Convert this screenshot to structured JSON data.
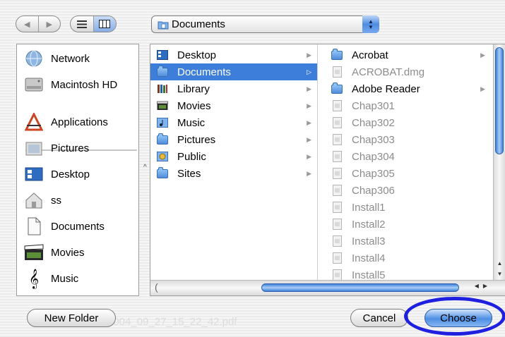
{
  "toolbar": {
    "back_icon": "back-arrow-icon",
    "forward_icon": "forward-arrow-icon",
    "list_view_icon": "list-view-icon",
    "column_view_icon": "column-view-icon"
  },
  "path_popup": {
    "label": "Documents",
    "icon": "documents-folder-icon"
  },
  "sidebar": {
    "items": [
      {
        "label": "Network",
        "icon": "network-globe-icon"
      },
      {
        "label": "Macintosh HD",
        "icon": "hard-drive-icon"
      },
      {
        "label": "Applications",
        "icon": "applications-icon"
      },
      {
        "label": "Pictures",
        "icon": "pictures-folder-icon"
      },
      {
        "label": "Desktop",
        "icon": "desktop-folder-icon"
      },
      {
        "label": "ss",
        "icon": "home-icon"
      },
      {
        "label": "Documents",
        "icon": "document-icon"
      },
      {
        "label": "Movies",
        "icon": "movies-clapper-icon"
      },
      {
        "label": "Music",
        "icon": "music-note-icon"
      }
    ]
  },
  "browser": {
    "column1": [
      {
        "label": "Desktop",
        "selected": false
      },
      {
        "label": "Documents",
        "selected": true
      },
      {
        "label": "Library",
        "selected": false
      },
      {
        "label": "Movies",
        "selected": false
      },
      {
        "label": "Music",
        "selected": false
      },
      {
        "label": "Pictures",
        "selected": false
      },
      {
        "label": "Public",
        "selected": false
      },
      {
        "label": "Sites",
        "selected": false
      }
    ],
    "column2": [
      {
        "label": "Acrobat",
        "type": "folder"
      },
      {
        "label": "ACROBAT.dmg",
        "type": "file"
      },
      {
        "label": "Adobe Reader",
        "type": "folder"
      },
      {
        "label": "Chap301",
        "type": "file"
      },
      {
        "label": "Chap302",
        "type": "file"
      },
      {
        "label": "Chap303",
        "type": "file"
      },
      {
        "label": "Chap304",
        "type": "file"
      },
      {
        "label": "Chap305",
        "type": "file"
      },
      {
        "label": "Chap306",
        "type": "file"
      },
      {
        "label": "Install1",
        "type": "file"
      },
      {
        "label": "Install2",
        "type": "file"
      },
      {
        "label": "Install3",
        "type": "file"
      },
      {
        "label": "Install4",
        "type": "file"
      },
      {
        "label": "Install5",
        "type": "file"
      }
    ]
  },
  "buttons": {
    "new_folder": "New Folder",
    "cancel": "Cancel",
    "choose": "Choose"
  },
  "background_text": "2004_09_27_15_22_42.pdf",
  "colors": {
    "selection": "#3e7edb",
    "annotation_ring": "#1f1fe0"
  }
}
